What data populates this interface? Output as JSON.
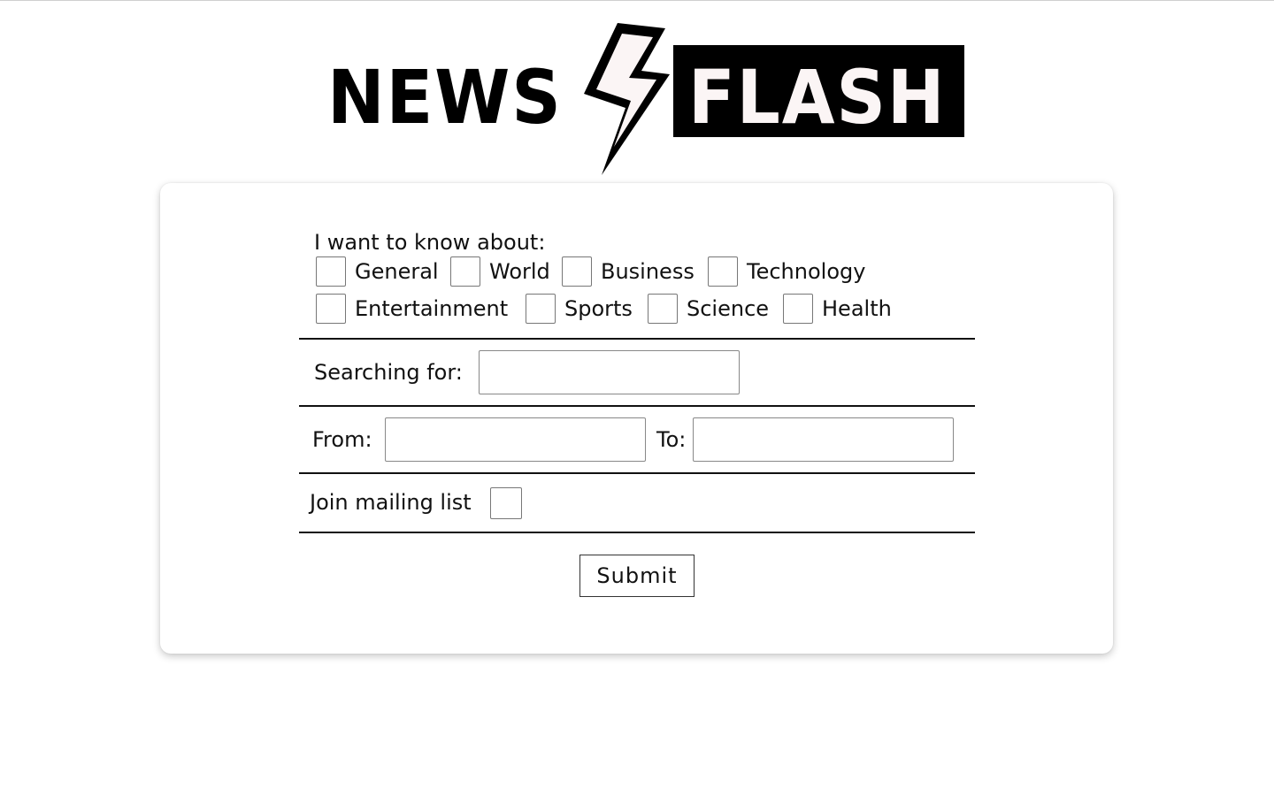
{
  "logo": {
    "word_left": "NEWS",
    "word_right": "FLASH",
    "bolt_icon": "lightning-bolt-icon",
    "colors": {
      "ink": "#000000",
      "flash_text": "#fbf5f5",
      "bolt_fill": "#fbf5f5"
    }
  },
  "form": {
    "topics_label": "I want to know about:",
    "topics": [
      "General",
      "World",
      "Business",
      "Technology",
      "Entertainment",
      "Sports",
      "Science",
      "Health"
    ],
    "search_label": "Searching for:",
    "search_value": "",
    "from_label": "From:",
    "from_value": "",
    "to_label": "To:",
    "to_value": "",
    "mailing_label": "Join mailing list",
    "submit_label": "Submit"
  }
}
